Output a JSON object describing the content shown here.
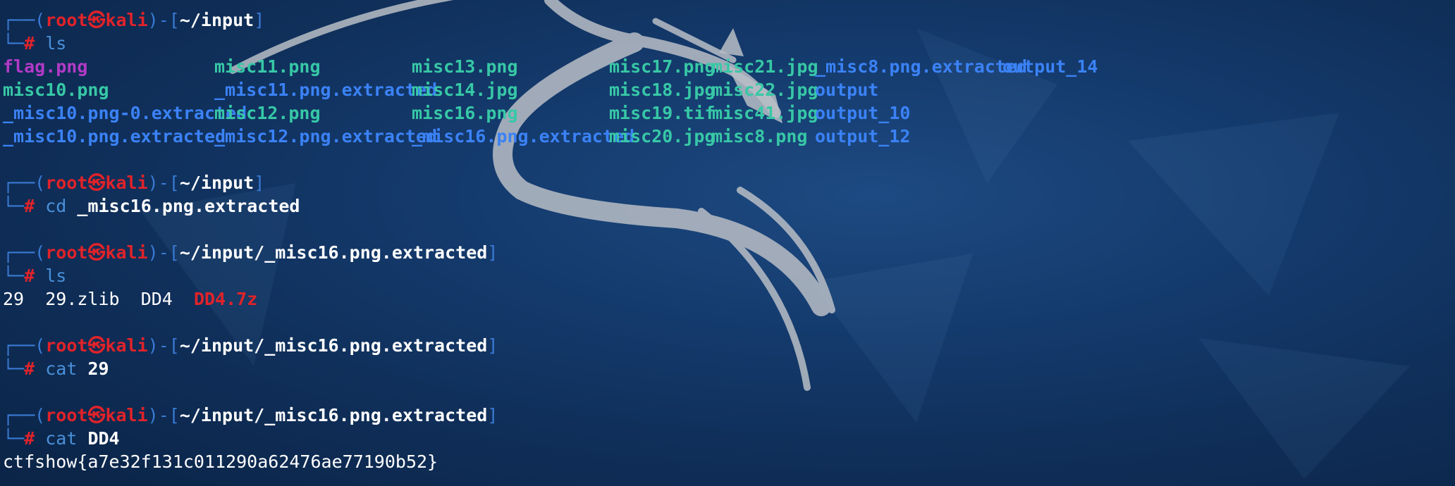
{
  "prompt": {
    "box_top": "┌──(",
    "user": "root",
    "skull": "㉿",
    "host": "kali",
    "sep": ")-[",
    "close": "]",
    "box_bottom": "└─",
    "hash": "#"
  },
  "blocks": [
    {
      "path": "~/input",
      "command": "ls",
      "args": ""
    },
    {
      "path": "~/input",
      "command": "cd",
      "args": "_misc16.png.extracted"
    },
    {
      "path": "~/input/_misc16.png.extracted",
      "command": "ls",
      "args": ""
    },
    {
      "path": "~/input/_misc16.png.extracted",
      "command": "cat",
      "args": "29"
    },
    {
      "path": "~/input/_misc16.png.extracted",
      "command": "cat",
      "args": "DD4"
    }
  ],
  "ls_input": {
    "rows": [
      [
        "flag.png",
        "misc11.png",
        "misc13.png",
        "misc17.png",
        "misc21.jpg",
        "_misc8.png.extracted",
        "output_14"
      ],
      [
        "misc10.png",
        "_misc11.png.extracted",
        "misc14.jpg",
        "misc18.jpg",
        "misc22.jpg",
        "output",
        ""
      ],
      [
        "_misc10.png-0.extracted",
        "misc12.png",
        "misc16.png",
        "misc19.tif",
        "misc41.jpg",
        "output_10",
        ""
      ],
      [
        "_misc10.png.extracted",
        "_misc12.png.extracted",
        "_misc16.png.extracted",
        "misc20.jpg",
        "misc8.png",
        "output_12",
        ""
      ]
    ]
  },
  "ls_extracted": {
    "items": [
      "29",
      "29.zlib",
      "DD4",
      "DD4.7z"
    ]
  },
  "flag_output": "ctfshow{a7e32f131c011290a62476ae77190b52}",
  "colors": {
    "prompt_red": "#e0232a",
    "box_blue": "#3a7bd5",
    "image_teal": "#37c8a6",
    "dir_blue": "#3b82f6",
    "magenta": "#b23ac7"
  }
}
